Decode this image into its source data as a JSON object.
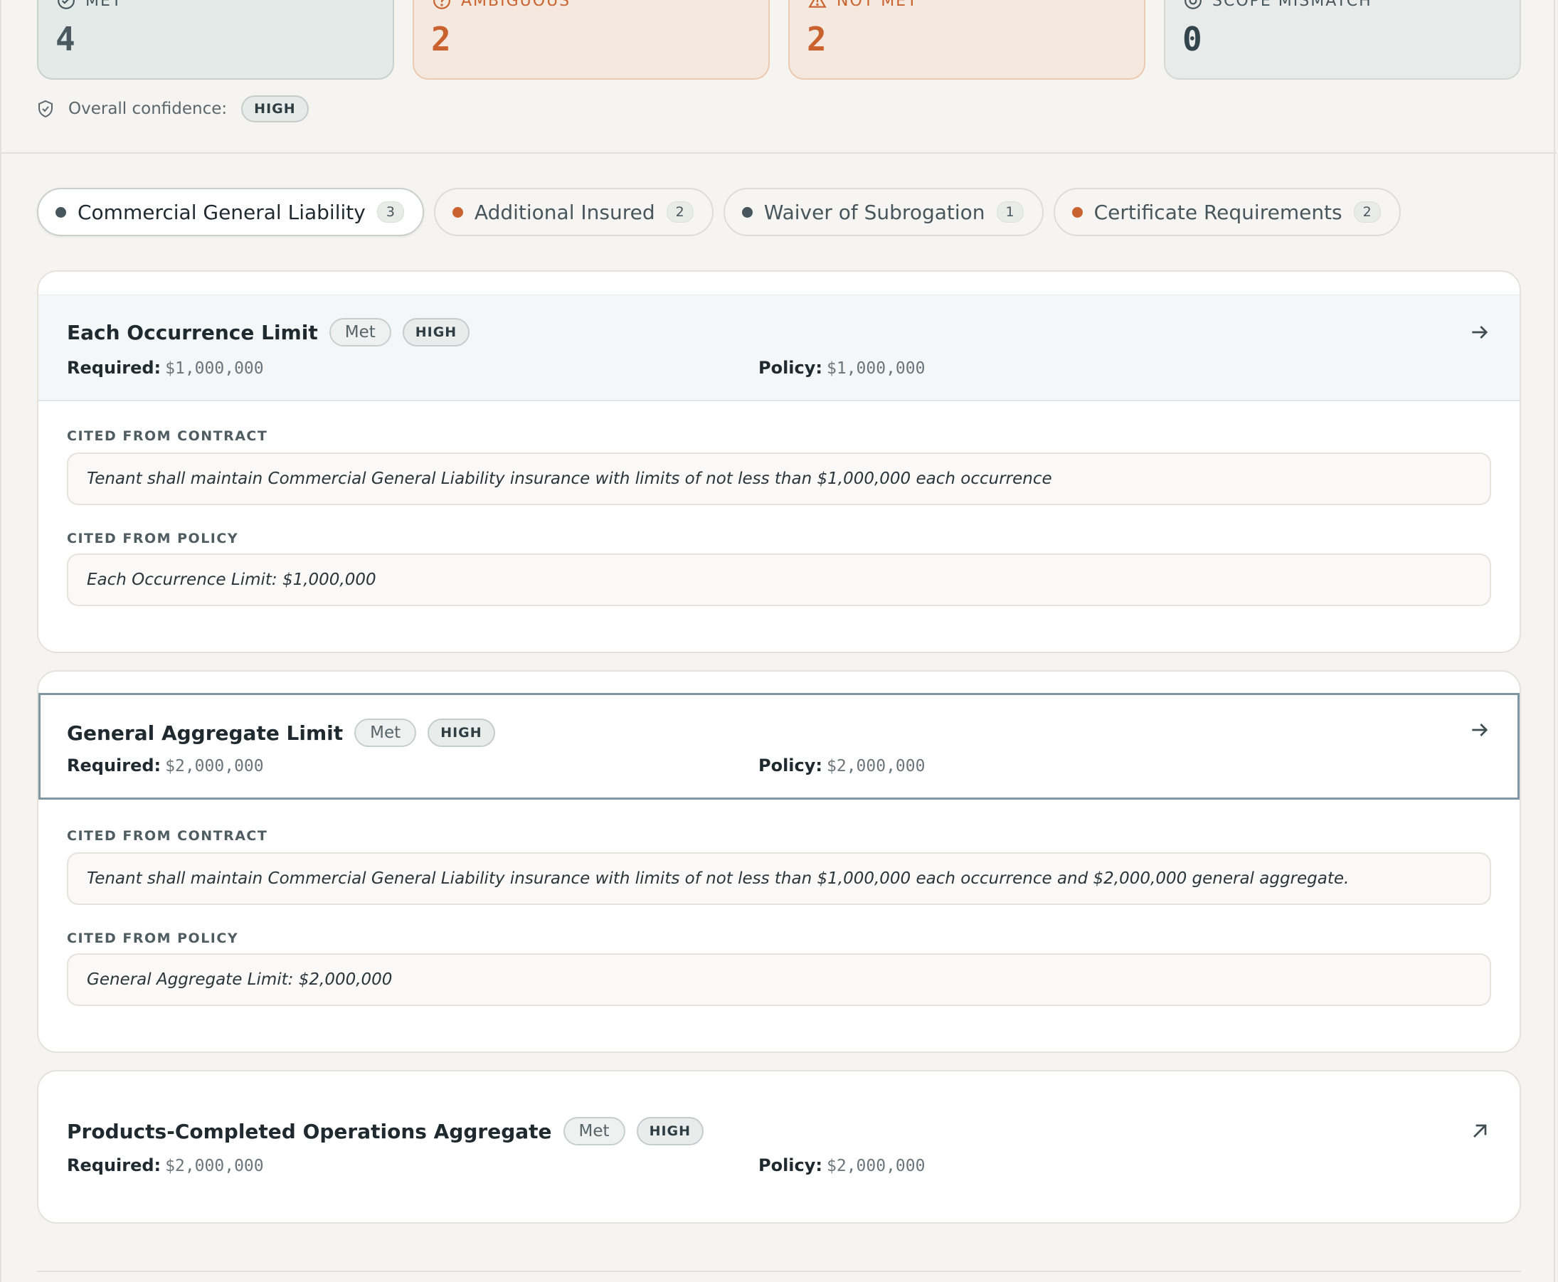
{
  "summary": [
    {
      "label": "MET",
      "value": "4",
      "kind": "met",
      "icon": "check-circle-icon"
    },
    {
      "label": "AMBIGUOUS",
      "value": "2",
      "kind": "warn",
      "icon": "help-circle-icon"
    },
    {
      "label": "NOT MET",
      "value": "2",
      "kind": "warn",
      "icon": "alert-triangle-icon"
    },
    {
      "label": "SCOPE MISMATCH",
      "value": "0",
      "kind": "neutral",
      "icon": "target-icon"
    }
  ],
  "confidence": {
    "label": "Overall confidence:",
    "value": "HIGH",
    "icon": "shield-check-icon"
  },
  "tabs": [
    {
      "label": "Commercial General Liability",
      "count": "3",
      "dot_color": "#47565d",
      "active": true
    },
    {
      "label": "Additional Insured",
      "count": "2",
      "dot_color": "#c9622e",
      "active": false
    },
    {
      "label": "Waiver of Subrogation",
      "count": "1",
      "dot_color": "#47565d",
      "active": false
    },
    {
      "label": "Certificate Requirements",
      "count": "2",
      "dot_color": "#c9622e",
      "active": false
    }
  ],
  "labels": {
    "required": "Required:",
    "policy": "Policy:",
    "cited_contract": "CITED FROM CONTRACT",
    "cited_policy": "CITED FROM POLICY"
  },
  "requirements": [
    {
      "title": "Each Occurrence Limit",
      "status": "Met",
      "confidence": "HIGH",
      "required": "$1,000,000",
      "policy": "$1,000,000",
      "contract_citation": "Tenant shall maintain Commercial General Liability insurance with limits of not less than $1,000,000 each occurrence",
      "policy_citation": "Each Occurrence Limit: $1,000,000",
      "icon": "arrow-right-icon"
    },
    {
      "title": "General Aggregate Limit",
      "status": "Met",
      "confidence": "HIGH",
      "required": "$2,000,000",
      "policy": "$2,000,000",
      "contract_citation": "Tenant shall maintain Commercial General Liability insurance with limits of not less than $1,000,000 each occurrence and $2,000,000 general aggregate.",
      "policy_citation": "General Aggregate Limit: $2,000,000",
      "icon": "arrow-right-icon"
    },
    {
      "title": "Products-Completed Operations Aggregate",
      "status": "Met",
      "confidence": "HIGH",
      "required": "$2,000,000",
      "policy": "$2,000,000",
      "icon": "arrow-up-right-icon"
    }
  ],
  "colors": {
    "accent_warn": "#c9622e",
    "accent_neutral": "#47565d",
    "focus_border": "#7e97a3"
  }
}
